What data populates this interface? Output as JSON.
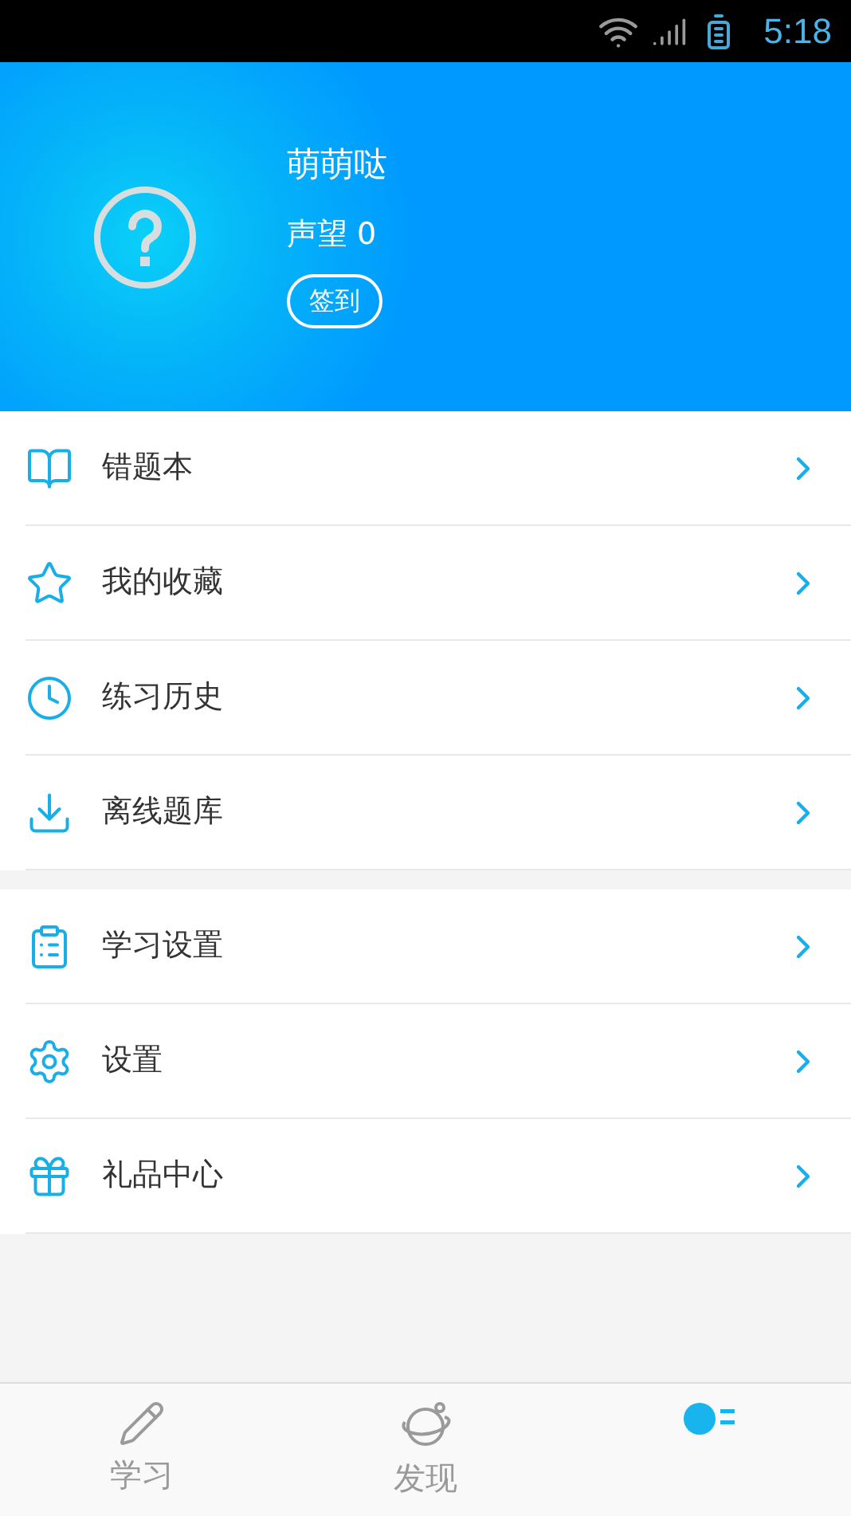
{
  "status_bar": {
    "time": "5:18"
  },
  "profile": {
    "name": "萌萌哒",
    "reputation": "声望 0",
    "checkin_button": "签到"
  },
  "menu_groups": [
    {
      "items": [
        {
          "label": "错题本"
        },
        {
          "label": "我的收藏"
        },
        {
          "label": "练习历史"
        },
        {
          "label": "离线题库"
        }
      ]
    },
    {
      "items": [
        {
          "label": "学习设置"
        },
        {
          "label": "设置"
        },
        {
          "label": "礼品中心"
        }
      ]
    }
  ],
  "tabs": [
    {
      "label": "学习",
      "selected": false
    },
    {
      "label": "发现",
      "selected": false
    },
    {
      "selected": true
    }
  ]
}
